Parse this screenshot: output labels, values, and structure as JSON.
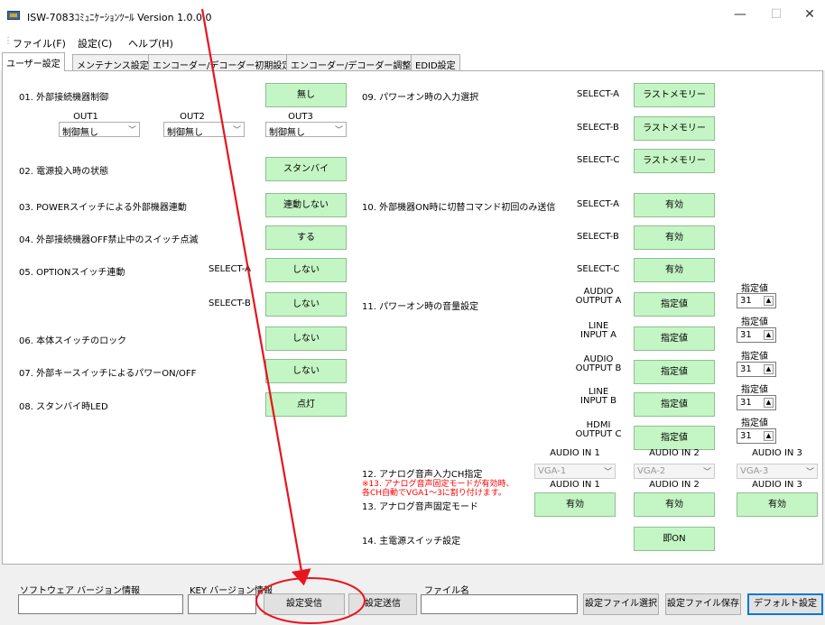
{
  "window": {
    "title": "ISW-7083ｺﾐｭﾆｹｰｼｮﾝﾂｰﾙ  Version 1.0.0.0",
    "minimize": "—",
    "maximize": "☐",
    "close": "✕"
  },
  "menu": [
    "ファイル(F)",
    "設定(C)",
    "ヘルプ(H)"
  ],
  "tabs": [
    "ユーザー設定",
    "メンテナンス設定",
    "エンコーダー/デコーダー初期設定",
    "エンコーダー/デコーダー調整",
    "EDID設定"
  ],
  "left": {
    "s01": {
      "label": "01. 外部接続機器制御",
      "btn": "無し"
    },
    "outs": [
      {
        "label": "OUT1",
        "value": "制御無し"
      },
      {
        "label": "OUT2",
        "value": "制御無し"
      },
      {
        "label": "OUT3",
        "value": "制御無し"
      }
    ],
    "s02": {
      "label": "02. 電源投入時の状態",
      "btn": "スタンバイ"
    },
    "s03": {
      "label": "03. POWERスイッチによる外部機器連動",
      "btn": "連動しない"
    },
    "s04": {
      "label": "04. 外部接続機器OFF禁止中のスイッチ点滅",
      "btn": "する"
    },
    "s05": {
      "label": "05. OPTIONスイッチ連動",
      "selA": "SELECT-A",
      "btnA": "しない",
      "selB": "SELECT-B",
      "btnB": "しない"
    },
    "s06": {
      "label": "06. 本体スイッチのロック",
      "btn": "しない"
    },
    "s07": {
      "label": "07. 外部キースイッチによるパワーON/OFF",
      "btn": "しない"
    },
    "s08": {
      "label": "08. スタンバイ時LED",
      "btn": "点灯"
    }
  },
  "right": {
    "s09": {
      "label": "09. パワーオン時の入力選択",
      "rows": [
        {
          "sel": "SELECT-A",
          "btn": "ラストメモリー"
        },
        {
          "sel": "SELECT-B",
          "btn": "ラストメモリー"
        },
        {
          "sel": "SELECT-C",
          "btn": "ラストメモリー"
        }
      ]
    },
    "s10": {
      "label": "10. 外部機器ON時に切替コマンド初回のみ送信",
      "rows": [
        {
          "sel": "SELECT-A",
          "btn": "有効"
        },
        {
          "sel": "SELECT-B",
          "btn": "有効"
        },
        {
          "sel": "SELECT-C",
          "btn": "有効"
        }
      ]
    },
    "s11": {
      "label": "11. パワーオン時の音量設定",
      "spec_label": "指定値",
      "rows": [
        {
          "l1": "AUDIO",
          "l2": "OUTPUT A",
          "btn": "指定値",
          "val": "31"
        },
        {
          "l1": "LINE",
          "l2": "INPUT A",
          "btn": "指定値",
          "val": "31"
        },
        {
          "l1": "AUDIO",
          "l2": "OUTPUT B",
          "btn": "指定値",
          "val": "31"
        },
        {
          "l1": "LINE",
          "l2": "INPUT B",
          "btn": "指定値",
          "val": "31"
        },
        {
          "l1": "HDMI",
          "l2": "OUTPUT C",
          "btn": "指定値",
          "val": "31"
        }
      ]
    },
    "s12": {
      "label": "12. アナログ音声入力CH指定",
      "heads": [
        "AUDIO IN 1",
        "AUDIO IN 2",
        "AUDIO IN 3"
      ],
      "vals": [
        "VGA-1",
        "VGA-2",
        "VGA-3"
      ]
    },
    "note1": "※13. アナログ音声固定モードが有効時、",
    "note2": "各CH自動でVGA1～3に割り付けます。",
    "s13": {
      "label": "13. アナログ音声固定モード",
      "heads": [
        "AUDIO IN 1",
        "AUDIO IN 2",
        "AUDIO IN 3"
      ],
      "btns": [
        "有効",
        "有効",
        "有効"
      ]
    },
    "s14": {
      "label": "14. 主電源スイッチ設定",
      "btn": "即ON"
    }
  },
  "bottom": {
    "sw_label": "ソフトウェア バージョン情報",
    "key_label": "KEY バージョン情報",
    "file_label": "ファイル名",
    "recv": "設定受信",
    "send": "設定送信",
    "select_file": "設定ファイル選択",
    "save_file": "設定ファイル保存",
    "default": "デフォルト設定"
  },
  "annotation_color": "#e8141e"
}
